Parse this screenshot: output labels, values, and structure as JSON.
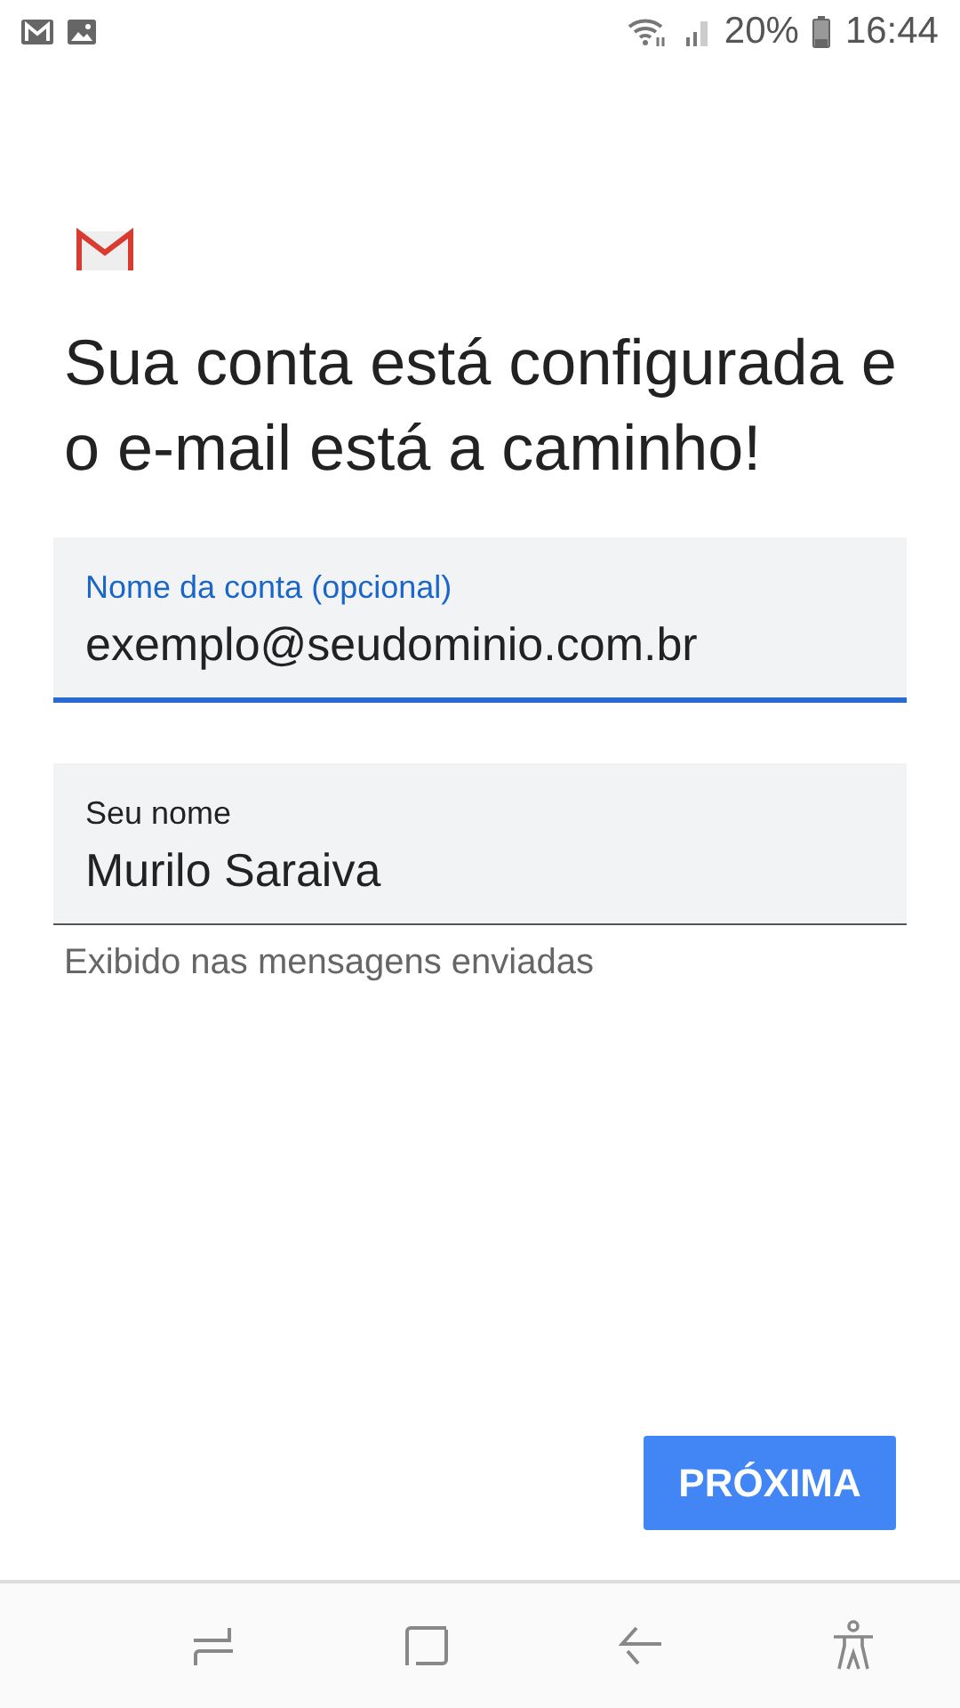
{
  "status_bar": {
    "battery": "20%",
    "time": "16:44"
  },
  "headline": "Sua conta está configurada e o e-mail está a caminho!",
  "fields": [
    {
      "label": "Nome da conta (opcional)",
      "value": "exemplo@seudominio.com.br",
      "focused": true
    },
    {
      "label": "Seu nome",
      "value": "Murilo Saraiva",
      "focused": false,
      "helper": "Exibido nas mensagens enviadas"
    }
  ],
  "next_button": "PRÓXIMA"
}
